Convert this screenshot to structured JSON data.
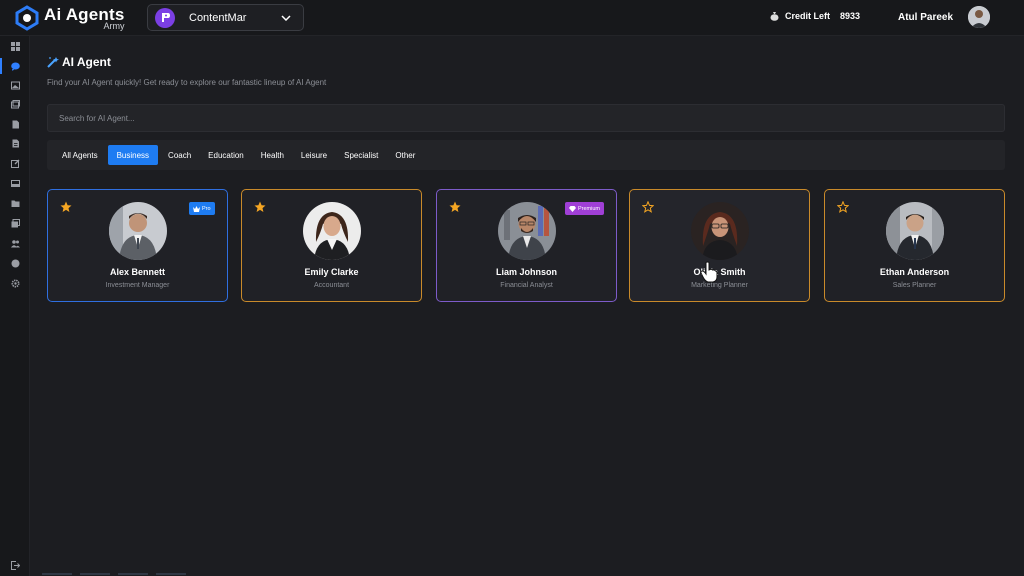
{
  "brand": {
    "name": "Ai Agents",
    "subtitle": "Army"
  },
  "workspace": {
    "name": "ContentMar"
  },
  "header": {
    "credit_label": "Credit Left",
    "credit_value": "8933",
    "user_name": "Atul Pareek"
  },
  "colors": {
    "accent": "#1e7cf2",
    "star": "#f5a623",
    "pro_border": "#2f6fe0",
    "premium_border": "#7d5bc9",
    "orange_border": "#c98a2a",
    "premium_badge": "#a03fd6"
  },
  "sidebar": {
    "items": [
      {
        "icon": "grid-icon"
      },
      {
        "icon": "chat-icon"
      },
      {
        "icon": "image-icon"
      },
      {
        "icon": "gallery-icon"
      },
      {
        "icon": "document-icon"
      },
      {
        "icon": "file-icon"
      },
      {
        "icon": "edit-icon"
      },
      {
        "icon": "inbox-icon"
      },
      {
        "icon": "folder-icon"
      },
      {
        "icon": "images-icon"
      },
      {
        "icon": "users-icon"
      },
      {
        "icon": "circle-icon"
      },
      {
        "icon": "settings-icon"
      },
      {
        "icon": "logout-icon"
      }
    ]
  },
  "page": {
    "title": "AI Agent",
    "subtitle": "Find your AI Agent quickly! Get ready to explore our fantastic lineup of AI Agent",
    "search_placeholder": "Search for AI Agent..."
  },
  "tabs": [
    {
      "label": "All Agents"
    },
    {
      "label": "Business"
    },
    {
      "label": "Coach"
    },
    {
      "label": "Education"
    },
    {
      "label": "Health"
    },
    {
      "label": "Leisure"
    },
    {
      "label": "Specialist"
    },
    {
      "label": "Other"
    }
  ],
  "active_tab": "Business",
  "agents": [
    {
      "name": "Alex Bennett",
      "role": "Investment Manager",
      "favorite": true,
      "badge": "Pro"
    },
    {
      "name": "Emily Clarke",
      "role": "Accountant",
      "favorite": true,
      "badge": ""
    },
    {
      "name": "Liam Johnson",
      "role": "Financial Analyst",
      "favorite": true,
      "badge": "Premium"
    },
    {
      "name": "Olivia Smith",
      "role": "Marketing Planner",
      "favorite": false,
      "badge": ""
    },
    {
      "name": "Ethan Anderson",
      "role": "Sales Planner",
      "favorite": false,
      "badge": ""
    }
  ]
}
